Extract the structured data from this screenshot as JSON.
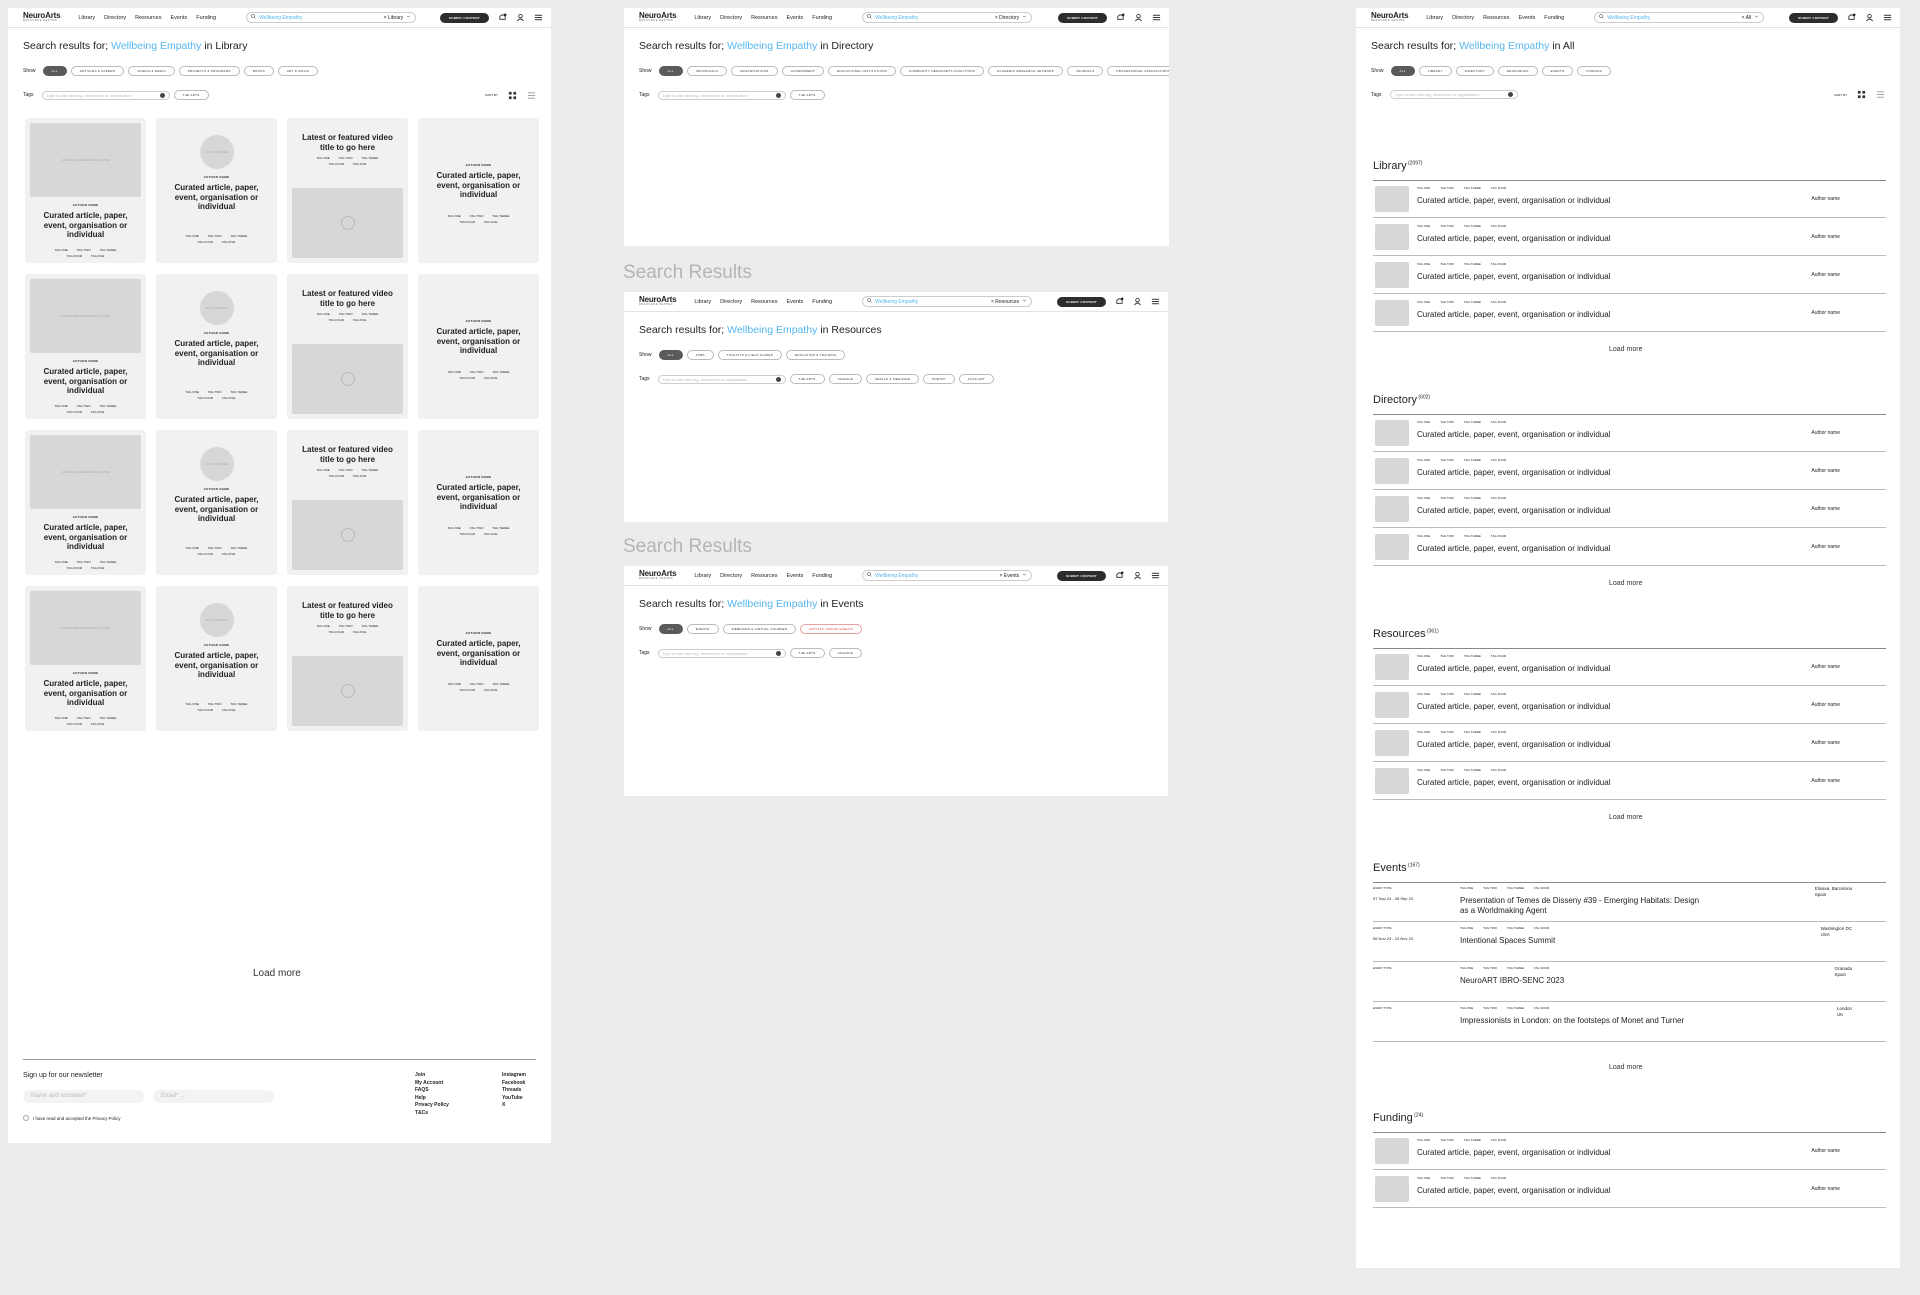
{
  "nav": {
    "brand": "NeuroArts",
    "brand_sub": "RESOURCE CENTER",
    "links": [
      "Library",
      "Directory",
      "Resources",
      "Events",
      "Funding"
    ],
    "search_value": "Wellbeing Empathy",
    "submit_label": "SUBMIT CONTENT"
  },
  "common": {
    "prefix": "Search results for;",
    "term": "Wellbeing Empathy",
    "in": "in",
    "show_label": "Show",
    "tags_label": "Tags",
    "tags_placeholder": "Type to add new tag, researcher or organisation",
    "sort_by": "SORT BY",
    "load_more": "Load more",
    "card_title": "Curated article, paper, event, organisation or individual",
    "video_title": "Latest or featured video title to go here",
    "author_label": "AUTHOR NAME",
    "image_label": "COVER IMAGE RESOURCE NAME",
    "tags": [
      "TAG ONE",
      "TAG TWO",
      "TAG THREE",
      "TAG FOUR",
      "TAG FIVE"
    ],
    "row_tags": [
      "TAG ONE",
      "TAG TWO",
      "TAG THREE",
      "TAG FOUR"
    ],
    "author_name": "Author name",
    "frame_label": "Search Results"
  },
  "library": {
    "category": "Library",
    "filters": [
      "ALL",
      "ARTICLES & PAPERS",
      "VIDEOS & MEDIA",
      "PROJECTS & PROGRAMS",
      "BOOKS",
      "ART & MUSIC"
    ]
  },
  "directory": {
    "category": "Directory",
    "filters": [
      "ALL",
      "INDIVIDUALS",
      "ORGANISATIONS",
      "GOVERNMENT",
      "EDUCATIONAL INSTITUTIONS",
      "COMMUNITY NEUROARTS COALITIONS",
      "ACADEMIC RESEARCH NETWORK",
      "JOURNALS",
      "PROFESSIONAL ASSOCIATIONS"
    ],
    "active_tag": "THE ARTS"
  },
  "resources": {
    "category": "Resources",
    "filters": [
      "ALL",
      "JOBS",
      "TOOLKITS & FIELD GUIDES",
      "EDUCATION & TRAINING"
    ],
    "active_tags": [
      "THE ARTS",
      "SCIENCE",
      "HEALTH & MEDICINE",
      "POETRY",
      "FOLK ART"
    ]
  },
  "events": {
    "category": "Events",
    "filters": [
      "ALL",
      "EVENTS",
      "WEBINARS & VIRTUAL COURSES",
      "ARTISTS' GROUP EVENTS"
    ],
    "active_tags": [
      "THE ARTS",
      "SCIENCE"
    ]
  },
  "all": {
    "category": "All",
    "filters": [
      "ALL",
      "LIBRARY",
      "DIRECTORY",
      "RESOURCES",
      "EVENTS",
      "FUNDING"
    ],
    "sections": [
      {
        "name": "Library",
        "count": "(2097)"
      },
      {
        "name": "Directory",
        "count": "(602)"
      },
      {
        "name": "Resources",
        "count": "(361)"
      },
      {
        "name": "Events",
        "count": "(167)"
      },
      {
        "name": "Funding",
        "count": "(24)"
      }
    ],
    "event_type": "EVENT TYPE",
    "events": [
      {
        "date": "07 Sep 23 - 08 Sep 23",
        "title": "Presentation of Temes de Disseny #39 - Emerging Habitats: Design as a Worldmaking Agent",
        "loc1": "Elisava, Barcelona",
        "loc2": "Spain"
      },
      {
        "date": "06 Nov 23 - 10 Nov 23",
        "title": "Intentional Spaces Summit",
        "loc1": "Washington DC",
        "loc2": "USA"
      },
      {
        "date": "",
        "title": "NeuroART IBRO-SENC 2023",
        "loc1": "Granada",
        "loc2": "Spain"
      },
      {
        "date": "",
        "title": "Impressionists in London: on the footsteps of Monet and Turner",
        "loc1": "London",
        "loc2": "UK"
      }
    ]
  },
  "footer": {
    "newsletter": "Sign up for our newsletter",
    "name_placeholder": "Name and surname*",
    "email_placeholder": "Email*",
    "policy": "I have read and accepted the Privacy Policy",
    "links1": [
      "Join",
      "My Account",
      "FAQS",
      "Help",
      "Privacy Policy",
      "T&Cs"
    ],
    "links2": [
      "Instagram",
      "Facebook",
      "Threads",
      "YouTube",
      "X"
    ]
  }
}
